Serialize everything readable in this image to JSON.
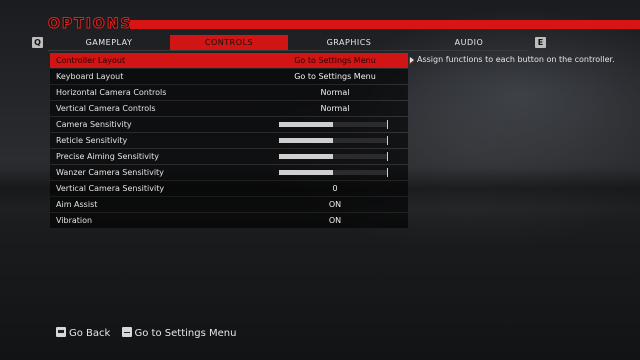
{
  "screen": {
    "title": "OPTIONS"
  },
  "tabs": {
    "left_key": "Q",
    "right_key": "E",
    "items": [
      {
        "label": "GAMEPLAY",
        "active": false
      },
      {
        "label": "CONTROLS",
        "active": true
      },
      {
        "label": "GRAPHICS",
        "active": false
      },
      {
        "label": "AUDIO",
        "active": false
      }
    ]
  },
  "settings": [
    {
      "label": "Controller Layout",
      "value": "Go to Settings Menu",
      "selected": true
    },
    {
      "label": "Keyboard Layout",
      "value": "Go to Settings Menu"
    },
    {
      "label": "Horizontal Camera Controls",
      "value": "Normal"
    },
    {
      "label": "Vertical Camera Controls",
      "value": "Normal"
    },
    {
      "label": "Camera Sensitivity",
      "slider": 0.5
    },
    {
      "label": "Reticle Sensitivity",
      "slider": 0.5
    },
    {
      "label": "Precise Aiming Sensitivity",
      "slider": 0.5
    },
    {
      "label": "Wanzer Camera Sensitivity",
      "slider": 0.5
    },
    {
      "label": "Vertical Camera Sensitivity",
      "value": "0"
    },
    {
      "label": "Aim Assist",
      "value": "ON"
    },
    {
      "label": "Vibration",
      "value": "ON"
    }
  ],
  "description": {
    "text": "Assign functions to each button on the controller."
  },
  "footer": {
    "back_label": "Go Back",
    "menu_label": "Go to Settings Menu"
  },
  "colors": {
    "accent": "#d11414",
    "row_bg": "#0a0a0a",
    "text": "#e8e8e8"
  }
}
